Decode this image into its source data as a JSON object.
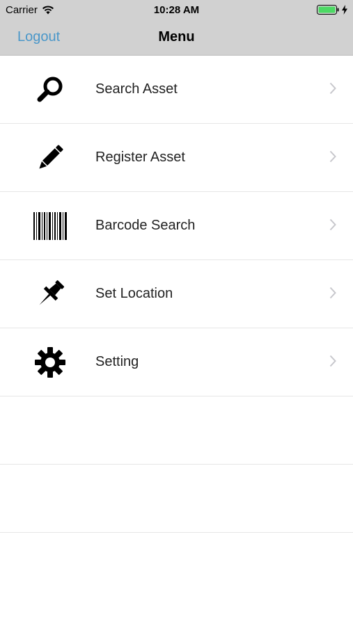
{
  "status_bar": {
    "carrier": "Carrier",
    "time": "10:28 AM",
    "battery_color": "#4cd964"
  },
  "nav": {
    "left_button": "Logout",
    "title": "Menu",
    "accent": "#4a97c9"
  },
  "menu": {
    "items": [
      {
        "label": "Search Asset",
        "icon": "magnifier-icon"
      },
      {
        "label": "Register Asset",
        "icon": "pencil-icon"
      },
      {
        "label": "Barcode Search",
        "icon": "barcode-icon"
      },
      {
        "label": "Set Location",
        "icon": "pushpin-icon"
      },
      {
        "label": "Setting",
        "icon": "gear-icon"
      }
    ]
  }
}
